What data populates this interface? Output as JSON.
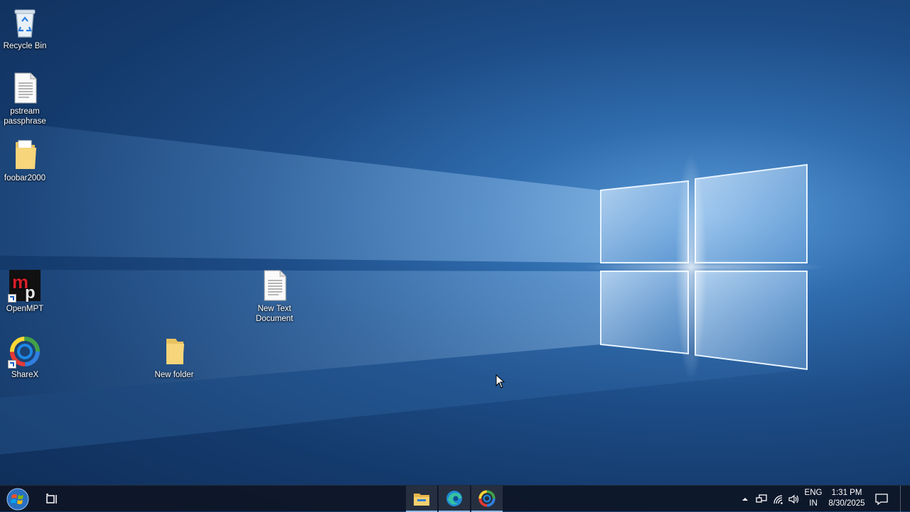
{
  "desktop": {
    "icons": [
      {
        "label": "Recycle Bin"
      },
      {
        "label": "pstream passphrase"
      },
      {
        "label": "foobar2000"
      },
      {
        "label": "OpenMPT"
      },
      {
        "label": "ShareX"
      },
      {
        "label": "New Text Document"
      },
      {
        "label": "New folder"
      }
    ]
  },
  "taskbar": {
    "start_icon": "windows-orb-icon",
    "task_view_icon": "task-view-icon",
    "pinned_apps": [
      "file-explorer-icon",
      "edge-icon",
      "sharex-icon"
    ],
    "tray": {
      "language_line1": "ENG",
      "language_line2": "IN",
      "time": "1:31 PM",
      "date": "8/30/2025"
    }
  }
}
